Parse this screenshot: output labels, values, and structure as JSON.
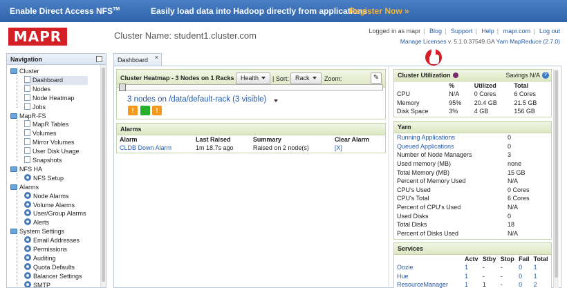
{
  "banner": {
    "text1": "Enable Direct Access NFS",
    "text1_sup": "TM",
    "text2": "Easily load data into Hadoop directly from applications",
    "cta": "Register Now »"
  },
  "header": {
    "logo": "MAPR",
    "cluster_name": "Cluster Name: student1.cluster.com",
    "logged_in": "Logged in as mapr",
    "links": [
      "Blog",
      "Support",
      "Help",
      "mapr.com",
      "Log out"
    ],
    "manage_licenses": "Manage Licenses",
    "version": "v. 5.1.0.37549.GA",
    "yarn_link": "Yarn MapReduce (2.7.0)"
  },
  "nav": {
    "title": "Navigation",
    "groups": [
      {
        "label": "Cluster",
        "items": [
          "Dashboard",
          "Nodes",
          "Node Heatmap",
          "Jobs"
        ]
      },
      {
        "label": "MapR-FS",
        "items": [
          "MapR Tables",
          "Volumes",
          "Mirror Volumes",
          "User Disk Usage",
          "Snapshots"
        ]
      },
      {
        "label": "NFS HA",
        "items": [
          "NFS Setup"
        ]
      },
      {
        "label": "Alarms",
        "items": [
          "Node Alarms",
          "Volume Alarms",
          "User/Group Alarms",
          "Alerts"
        ]
      },
      {
        "label": "System Settings",
        "items": [
          "Email Addresses",
          "Permissions",
          "Auditing",
          "Quota Defaults",
          "Balancer Settings",
          "SMTP"
        ]
      }
    ],
    "selected": "Dashboard"
  },
  "tab": {
    "label": "Dashboard",
    "close": "×"
  },
  "heatmap": {
    "title": "Cluster Heatmap - 3 Nodes on 1 Racks",
    "view_select": "Health",
    "sort_label": "| Sort:",
    "sort_select": "Rack",
    "zoom_label": "Zoom:",
    "rack_title": "3 nodes on /data/default-rack (3 visible)",
    "nodes": [
      {
        "status": "warning",
        "label": "!",
        "color": "#f39a1e"
      },
      {
        "status": "healthy",
        "label": "",
        "color": "#27b12a"
      },
      {
        "status": "warning",
        "label": "!",
        "color": "#f39a1e"
      }
    ]
  },
  "alarms": {
    "title": "Alarms",
    "columns": [
      "Alarm",
      "Last Raised",
      "Summary",
      "Clear Alarm"
    ],
    "rows": [
      {
        "alarm": "CLDB Down Alarm",
        "last_raised": "1m 18.7s ago",
        "summary": "Raised on 2 node(s)",
        "clear": "[X]"
      }
    ]
  },
  "utilization": {
    "title": "Cluster Utilization",
    "savings": "Savings N/A",
    "help": "?",
    "columns": [
      "",
      "%",
      "Utilized",
      "Total"
    ],
    "rows": [
      {
        "name": "CPU",
        "pct": "N/A",
        "utilized": "0 Cores",
        "total": "6 Cores"
      },
      {
        "name": "Memory",
        "pct": "95%",
        "utilized": "20.4 GB",
        "total": "21.5 GB"
      },
      {
        "name": "Disk Space",
        "pct": "3%",
        "utilized": "4 GB",
        "total": "156 GB"
      }
    ]
  },
  "yarn": {
    "title": "Yarn",
    "rows": [
      {
        "label": "Running Applications",
        "value": "0",
        "link": true
      },
      {
        "label": "Queued Applications",
        "value": "0",
        "link": true
      },
      {
        "label": "Number of Node Managers",
        "value": "3",
        "link": false
      },
      {
        "label": "Used memory (MB)",
        "value": "none",
        "link": false
      },
      {
        "label": "Total Memory (MB)",
        "value": "15 GB",
        "link": false
      },
      {
        "label": "Percent of Memory Used",
        "value": "N/A",
        "link": false
      },
      {
        "label": "CPU's Used",
        "value": "0 Cores",
        "link": false
      },
      {
        "label": "CPU's Total",
        "value": "6 Cores",
        "link": false
      },
      {
        "label": "Percent of CPU's Used",
        "value": "N/A",
        "link": false
      },
      {
        "label": "Used Disks",
        "value": "0",
        "link": false
      },
      {
        "label": "Total Disks",
        "value": "18",
        "link": false
      },
      {
        "label": "Percent of Disks Used",
        "value": "N/A",
        "link": false
      }
    ]
  },
  "services": {
    "title": "Services",
    "columns": [
      "",
      "Actv",
      "Stby",
      "Stop",
      "Fail",
      "Total"
    ],
    "rows": [
      {
        "name": "Oozie",
        "actv": "1",
        "stby": "-",
        "stop": "-",
        "fail": "0",
        "total": "1"
      },
      {
        "name": "Hue",
        "actv": "1",
        "stby": "-",
        "stop": "-",
        "fail": "0",
        "total": "1"
      },
      {
        "name": "ResourceManager",
        "actv": "1",
        "stby": "1",
        "stop": "-",
        "fail": "0",
        "total": "2"
      }
    ]
  }
}
